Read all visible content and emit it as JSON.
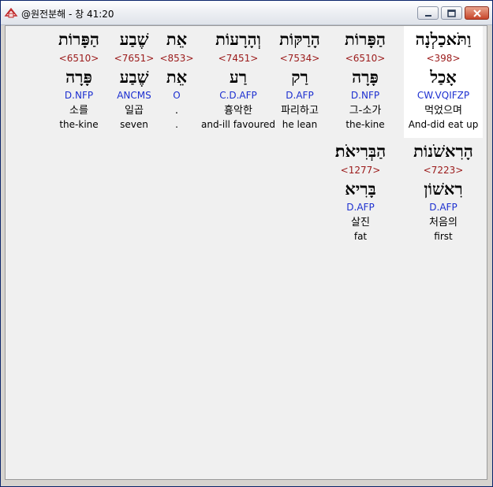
{
  "window": {
    "title": "@원전분해 - 창 41:20",
    "icon": "bible-app-icon",
    "controls": [
      "minimize",
      "maximize",
      "close"
    ]
  },
  "words": [
    {
      "hebrew": "וַתֹּאכַלְנָה",
      "strong": "<398>",
      "lemma": "אָכַל",
      "parse": "CW.VQIFZP",
      "korean": "먹었으며",
      "english": "And-did eat up",
      "selected": true
    },
    {
      "hebrew": "הַפָּרוֹת",
      "strong": "<6510>",
      "lemma": "פָּרָה",
      "parse": "D.NFP",
      "korean": "그-소가",
      "english": "the-kine",
      "selected": false
    },
    {
      "hebrew": "הָרַקּוֹת",
      "strong": "<7534>",
      "lemma": "רַק",
      "parse": "D.AFP",
      "korean": "파리하고",
      "english": "he lean",
      "selected": false
    },
    {
      "hebrew": "וְהָרָעוֹת",
      "strong": "<7451>",
      "lemma": "רַע",
      "parse": "C.D.AFP",
      "korean": "흉악한",
      "english": "and-ill favoured",
      "selected": false
    },
    {
      "hebrew": "אֵת",
      "strong": "<853>",
      "lemma": "אֵת",
      "parse": "O",
      "korean": ".",
      "english": ".",
      "selected": false
    },
    {
      "hebrew": "שֶׁבַע",
      "strong": "<7651>",
      "lemma": "שֶׁבַע",
      "parse": "ANCMS",
      "korean": "일곱",
      "english": "seven",
      "selected": false
    },
    {
      "hebrew": "הַפָּרוֹת",
      "strong": "<6510>",
      "lemma": "פָּרָה",
      "parse": "D.NFP",
      "korean": "소를",
      "english": "the-kine",
      "selected": false
    },
    {
      "hebrew": "הָרִאשֹׁנוֹת",
      "strong": "<7223>",
      "lemma": "רִאשׁוֹן",
      "parse": "D.AFP",
      "korean": "처음의",
      "english": "first",
      "selected": false
    },
    {
      "hebrew": "הַבְּרִיאֹת׃",
      "strong": "<1277>",
      "lemma": "בָּרִיא",
      "parse": "D.AFP",
      "korean": "살진",
      "english": "fat",
      "selected": false
    }
  ]
}
